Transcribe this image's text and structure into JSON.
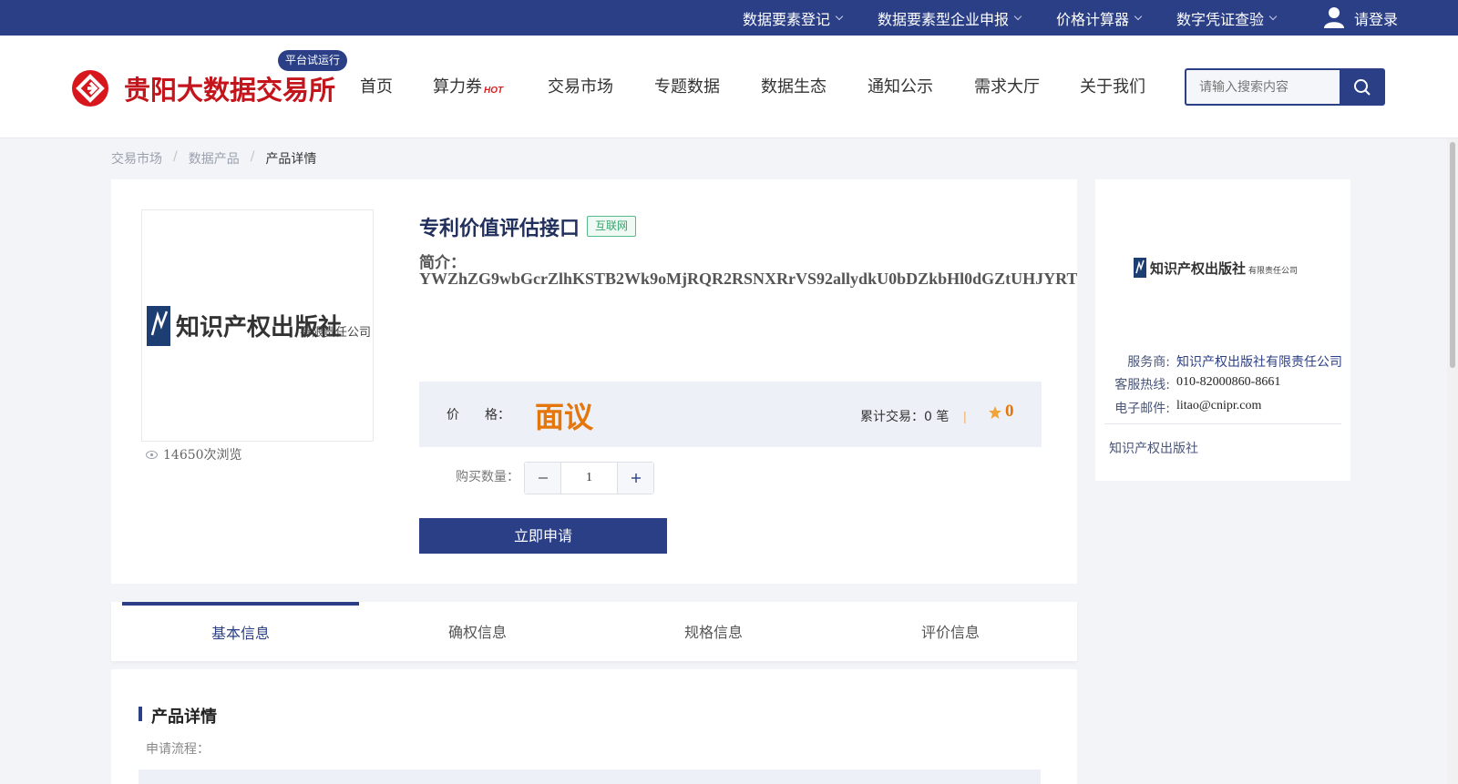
{
  "topbar": {
    "items": [
      {
        "label": "数据要素登记"
      },
      {
        "label": "数据要素型企业申报"
      },
      {
        "label": "价格计算器"
      },
      {
        "label": "数字凭证查验"
      }
    ],
    "login_label": "请登录"
  },
  "header": {
    "logo_text": "贵阳大数据交易所",
    "badge": "平台试运行",
    "nav": [
      "首页",
      "算力券",
      "交易市场",
      "专题数据",
      "数据生态",
      "通知公示",
      "需求大厅",
      "关于我们"
    ],
    "hot_label": "HOT",
    "search_placeholder": "请输入搜索内容"
  },
  "breadcrumb": [
    "交易市场",
    "数据产品",
    "产品详情"
  ],
  "product": {
    "title": "专利价值评估接口",
    "tag": "互联网",
    "intro_label": "简介：",
    "intro_text": "YWZhZG9wbGcrZlhKSTB2Wk9oMjRQR2RSNXRrVS92allydkU0bDZkbHl0dGZtUHJYRT",
    "views": "14650次浏览",
    "price_label": "价　　格：",
    "price_value": "面议",
    "trade_count": "累计交易：0 笔",
    "divider_char": "|",
    "rating": "0",
    "qty_label": "购买数量：",
    "qty_value": "1",
    "apply_label": "立即申请",
    "logo_text": "知识产权出版社 有限责任公司"
  },
  "vendor": {
    "rows": [
      {
        "k": "服务商:",
        "v": "知识产权出版社有限责任公司"
      },
      {
        "k": "客服热线:",
        "v": "010-82000860-8661"
      },
      {
        "k": "电子邮件:",
        "v": "litao@cnipr.com"
      }
    ],
    "footer": "知识产权出版社"
  },
  "tabs": [
    "基本信息",
    "确权信息",
    "规格信息",
    "评价信息"
  ],
  "detail": {
    "title": "产品详情",
    "sub": "申请流程："
  },
  "colors": {
    "brand": "#2b3f86",
    "logo_red": "#c4151c",
    "price_orange": "#e4760b"
  }
}
